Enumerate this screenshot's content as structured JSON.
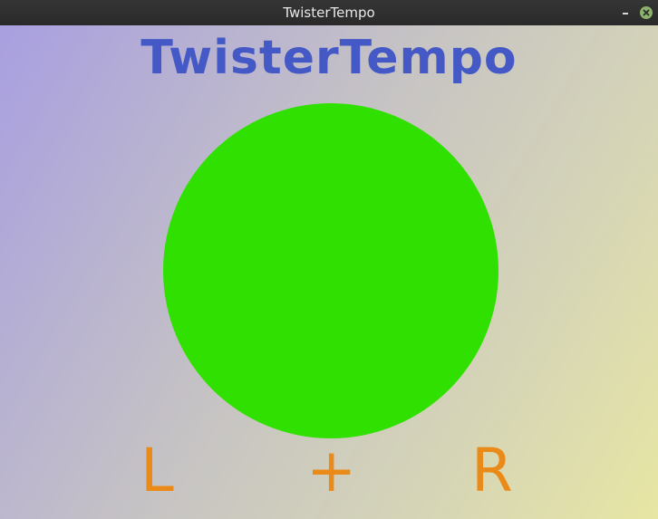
{
  "window": {
    "title": "TwisterTempo"
  },
  "app": {
    "heading": "TwisterTempo",
    "circle_color": "#2fe000",
    "heading_color": "#4459c6",
    "control_color": "#ea8a18"
  },
  "controls": {
    "left": "L",
    "add": "+",
    "right": "R"
  },
  "icons": {
    "minimize": "minimize-icon",
    "close": "close-icon"
  }
}
